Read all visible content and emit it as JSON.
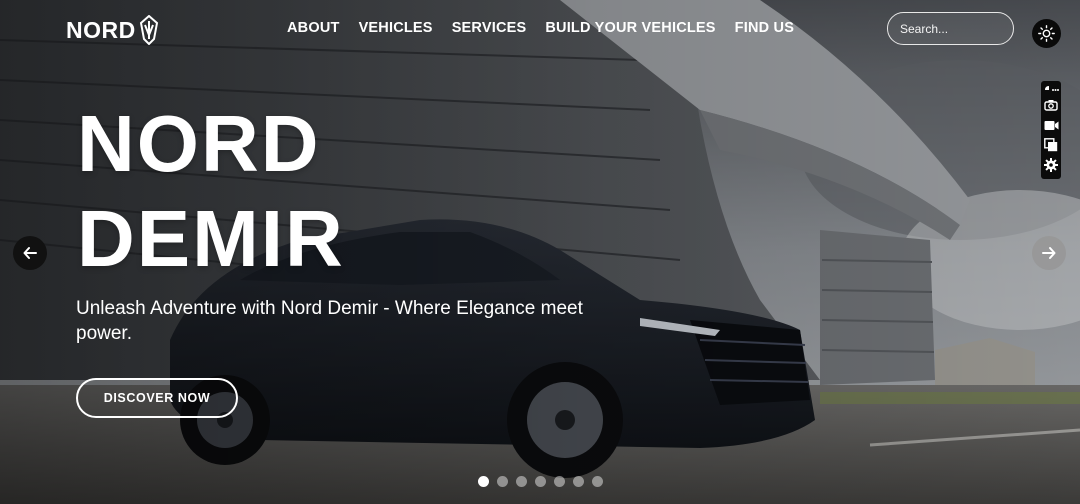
{
  "brand": {
    "name": "NORD",
    "logo_icon": "nord-emblem-icon"
  },
  "nav": {
    "items": [
      {
        "label": "ABOUT"
      },
      {
        "label": "VEHICLES"
      },
      {
        "label": "SERVICES"
      },
      {
        "label": "BUILD YOUR VEHICLES"
      },
      {
        "label": "FIND US"
      }
    ]
  },
  "search": {
    "placeholder": "Search..."
  },
  "theme_toggle": {
    "icon": "sun-icon"
  },
  "toolbar": {
    "icons": [
      "extension-icon",
      "camera-icon",
      "video-icon",
      "copy-icon",
      "gear-icon"
    ]
  },
  "hero": {
    "title_line1": "NORD",
    "title_line2": "DEMIR",
    "subtitle": "Unleash Adventure with Nord Demir - Where Elegance meet power.",
    "cta_label": "DISCOVER NOW"
  },
  "slider": {
    "prev_icon": "arrow-left-icon",
    "next_icon": "arrow-right-icon",
    "slide_count": 7,
    "active_index": 0
  },
  "colors": {
    "text": "#ffffff",
    "toolbar_bg": "#0b0b0b",
    "dot_inactive": "rgba(255,255,255,0.45)"
  }
}
